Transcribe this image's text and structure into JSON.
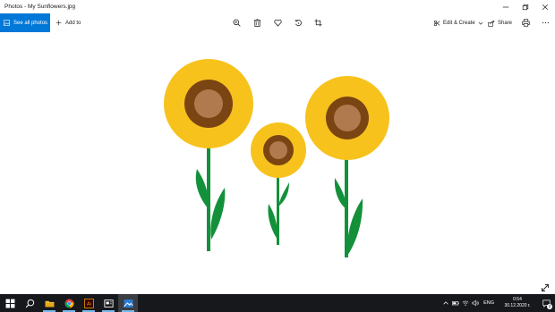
{
  "window": {
    "title": "Photos - My Sunflowers.jpg",
    "controls": [
      "minimize-icon",
      "maximize-icon",
      "close-icon"
    ]
  },
  "toolbar": {
    "see_all_label": "See all photos",
    "add_to_label": "Add to",
    "edit_create_label": "Edit & Create",
    "share_label": "Share",
    "icons": [
      "zoom-icon",
      "delete-icon",
      "favorite-icon",
      "rotate-icon",
      "crop-icon",
      "print-icon",
      "more-icon"
    ]
  },
  "photo": {
    "description_icon": "sunflowers-image",
    "colors": {
      "petal": "#f7c21c",
      "petal_dark": "#e8a317",
      "center_outer": "#7a4512",
      "center_inner": "#b07a4e",
      "stem": "#13913a"
    }
  },
  "taskbar": {
    "apps": [
      "windows-start-icon",
      "search-icon",
      "file-explorer-icon",
      "chrome-icon",
      "illustrator-icon",
      "screenshot-tool-icon",
      "photos-icon"
    ],
    "illustrator_label": "Ai",
    "language": "ENG",
    "time": "0:54",
    "date": "30.12.2020 г.",
    "notification_count": "2"
  },
  "accent": "#0078d7"
}
